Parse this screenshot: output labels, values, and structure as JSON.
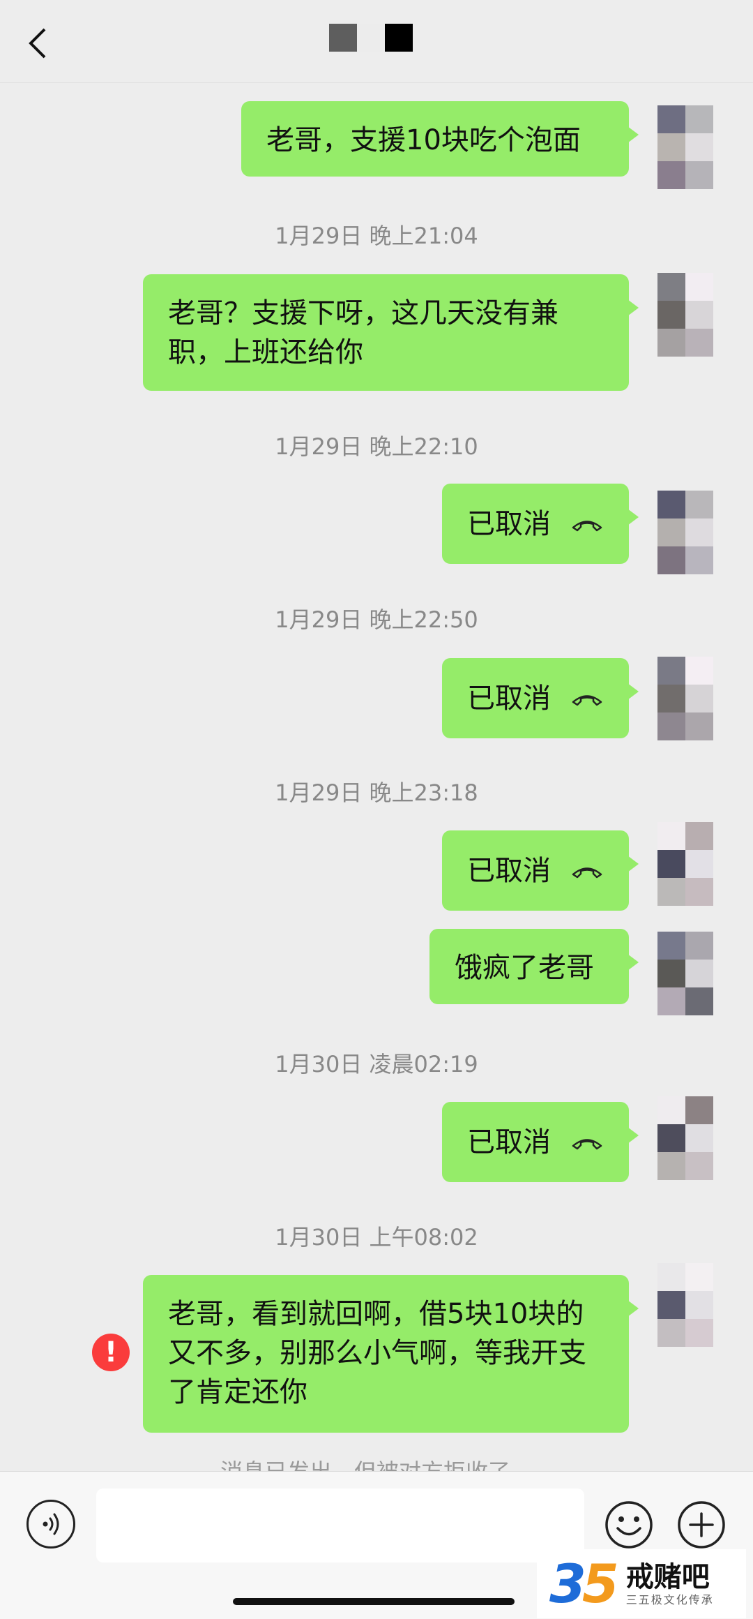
{
  "header": {
    "back_icon": "chevron-left-icon",
    "title_mosaic_colors": [
      "#5e5e5e",
      "#ececec",
      "#000000"
    ]
  },
  "messages": [
    {
      "text": "老哥，支援10块吃个泡面"
    },
    {
      "timestamp": "1月29日 晚上21:04"
    },
    {
      "text": "老哥？支援下呀，这几天没有兼职，上班还给你"
    },
    {
      "timestamp": "1月29日 晚上22:10"
    },
    {
      "text": "已取消",
      "icon": "hangup-icon"
    },
    {
      "timestamp": "1月29日 晚上22:50"
    },
    {
      "text": "已取消",
      "icon": "hangup-icon"
    },
    {
      "timestamp": "1月29日 晚上23:18"
    },
    {
      "text": "已取消",
      "icon": "hangup-icon"
    },
    {
      "text": "饿疯了老哥"
    },
    {
      "timestamp": "1月30日 凌晨02:19"
    },
    {
      "text": "已取消",
      "icon": "hangup-icon"
    },
    {
      "timestamp": "1月30日 上午08:02"
    },
    {
      "text": "老哥，看到就回啊，借5块10块的又不多，别那么小气啊，等我开支了肯定还你",
      "status": "failed",
      "status_icon": "error-icon"
    }
  ],
  "hint_text": "消息已发出，但被对方拒收了。",
  "input_bar": {
    "voice_icon": "voice-icon",
    "input_value": "",
    "emoji_icon": "emoji-icon",
    "plus_icon": "plus-icon"
  },
  "watermark": {
    "logo_number": "35",
    "logo_text": "戒赌吧",
    "subtitle": "三五极文化传承"
  },
  "colors": {
    "bubble": "#95ec69",
    "background": "#ededed",
    "error": "#fa3c3c"
  }
}
